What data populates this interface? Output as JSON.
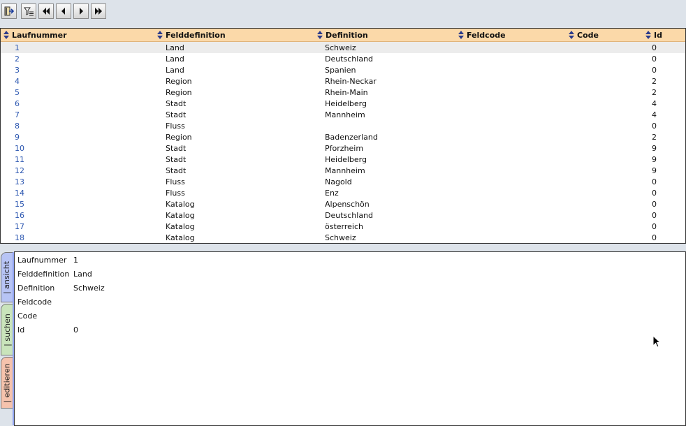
{
  "toolbar": {
    "buttons": [
      {
        "name": "exit-icon"
      },
      {
        "name": "filter-icon"
      },
      {
        "name": "first-record-icon"
      },
      {
        "name": "previous-record-icon"
      },
      {
        "name": "next-record-icon"
      },
      {
        "name": "last-record-icon"
      }
    ]
  },
  "grid": {
    "columns": [
      "Laufnummer",
      "Felddefinition",
      "Definition",
      "Feldcode",
      "Code",
      "Id"
    ],
    "rows": [
      [
        "1",
        "Land",
        "Schweiz",
        "",
        "",
        "0"
      ],
      [
        "2",
        "Land",
        "Deutschland",
        "",
        "",
        "0"
      ],
      [
        "3",
        "Land",
        "Spanien",
        "",
        "",
        "0"
      ],
      [
        "4",
        "Region",
        "Rhein-Neckar",
        "",
        "",
        "2"
      ],
      [
        "5",
        "Region",
        "Rhein-Main",
        "",
        "",
        "2"
      ],
      [
        "6",
        "Stadt",
        "Heidelberg",
        "",
        "",
        "4"
      ],
      [
        "7",
        "Stadt",
        "Mannheim",
        "",
        "",
        "4"
      ],
      [
        "8",
        "Fluss",
        "",
        "",
        "",
        "0"
      ],
      [
        "9",
        "Region",
        "Badenzerland",
        "",
        "",
        "2"
      ],
      [
        "10",
        "Stadt",
        "Pforzheim",
        "",
        "",
        "9"
      ],
      [
        "11",
        "Stadt",
        "Heidelberg",
        "",
        "",
        "9"
      ],
      [
        "12",
        "Stadt",
        "Mannheim",
        "",
        "",
        "9"
      ],
      [
        "13",
        "Fluss",
        "Nagold",
        "",
        "",
        "0"
      ],
      [
        "14",
        "Fluss",
        "Enz",
        "",
        "",
        "0"
      ],
      [
        "15",
        "Katalog",
        "Alpenschön",
        "",
        "",
        "0"
      ],
      [
        "16",
        "Katalog",
        "Deutschland",
        "",
        "",
        "0"
      ],
      [
        "17",
        "Katalog",
        "österreich",
        "",
        "",
        "0"
      ],
      [
        "18",
        "Katalog",
        "Schweiz",
        "",
        "",
        "0"
      ]
    ],
    "selected_row": 0
  },
  "tabs": {
    "ansicht": "| ansicht",
    "suchen": "| suchen",
    "editieren": "| editieren"
  },
  "detail": {
    "fields": [
      {
        "label": "Laufnummer",
        "value": "1"
      },
      {
        "label": "Felddefinition",
        "value": "Land"
      },
      {
        "label": "Definition",
        "value": "Schweiz"
      },
      {
        "label": "Feldcode",
        "value": ""
      },
      {
        "label": "Code",
        "value": ""
      },
      {
        "label": "Id",
        "value": "0"
      }
    ]
  },
  "colors": {
    "header_bg": "#fbd9a9",
    "tab_ansicht": "#b7c4f5",
    "tab_suchen": "#c9e4bb",
    "tab_editieren": "#f6c3ad",
    "link": "#2b56b0"
  }
}
